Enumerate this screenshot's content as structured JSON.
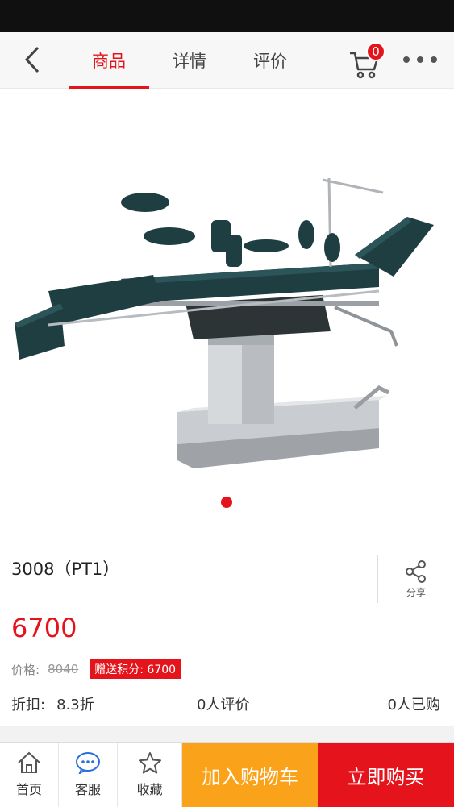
{
  "topnav": {
    "tabs": [
      {
        "label": "商品",
        "active": true
      },
      {
        "label": "详情",
        "active": false
      },
      {
        "label": "评价",
        "active": false
      }
    ],
    "cart_count": "0",
    "icons": {
      "back": "chevron-left-icon",
      "cart": "cart-icon",
      "more": "more-dots-icon"
    }
  },
  "gallery": {
    "image": "surgical-table-photo",
    "page_count": 1,
    "active_index": 0
  },
  "product": {
    "title": "3008（PT1）",
    "price": "6700",
    "original_price_label": "价格:",
    "original_price": "8040",
    "points_badge": "赠送积分: 6700",
    "share_label": "分享",
    "discount_label": "折扣:",
    "discount_value": "8.3折",
    "reviews": "0人评价",
    "sold": "0人已购"
  },
  "bottombar": {
    "home": "首页",
    "service": "客服",
    "favorite": "收藏",
    "add_to_cart": "加入购物车",
    "buy_now": "立即购买"
  },
  "colors": {
    "accent": "#e5141c",
    "cart_button": "#fba21b"
  }
}
